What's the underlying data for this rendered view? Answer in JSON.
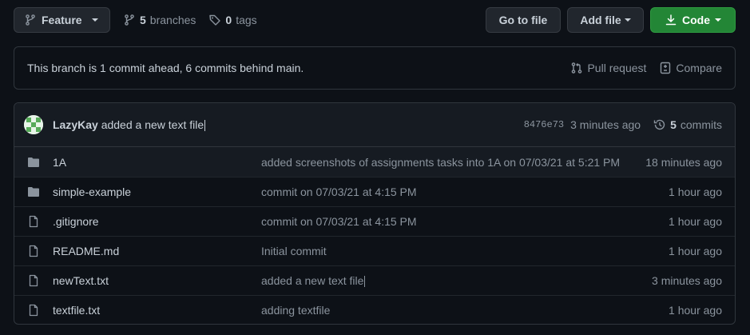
{
  "toolbar": {
    "branch_label": "Feature",
    "branches_count": "5",
    "branches_label": "branches",
    "tags_count": "0",
    "tags_label": "tags",
    "goto_file_label": "Go to file",
    "add_file_label": "Add file",
    "code_label": "Code"
  },
  "branch_status": {
    "text": "This branch is 1 commit ahead, 6 commits behind main.",
    "pull_request_label": "Pull request",
    "compare_label": "Compare"
  },
  "latest_commit": {
    "author": "LazyKay",
    "message": "added a new text file",
    "sha": "8476e73",
    "age": "3 minutes ago",
    "commits_count": "5",
    "commits_label": "commits"
  },
  "files": [
    {
      "type": "folder",
      "name": "1A",
      "message": "added screenshots of assignments tasks into 1A on 07/03/21 at 5:21 PM",
      "age": "18 minutes ago"
    },
    {
      "type": "folder",
      "name": "simple-example",
      "message": "commit on 07/03/21 at 4:15 PM",
      "age": "1 hour ago"
    },
    {
      "type": "file",
      "name": ".gitignore",
      "message": "commit on 07/03/21 at 4:15 PM",
      "age": "1 hour ago"
    },
    {
      "type": "file",
      "name": "README.md",
      "message": "Initial commit",
      "age": "1 hour ago"
    },
    {
      "type": "file",
      "name": "newText.txt",
      "message": "added a new text file",
      "age": "3 minutes ago"
    },
    {
      "type": "file",
      "name": "textfile.txt",
      "message": "adding textfile",
      "age": "1 hour ago"
    }
  ],
  "colors": {
    "background": "#0d1117",
    "code_button": "#238636",
    "folder_icon": "#8b949e"
  }
}
